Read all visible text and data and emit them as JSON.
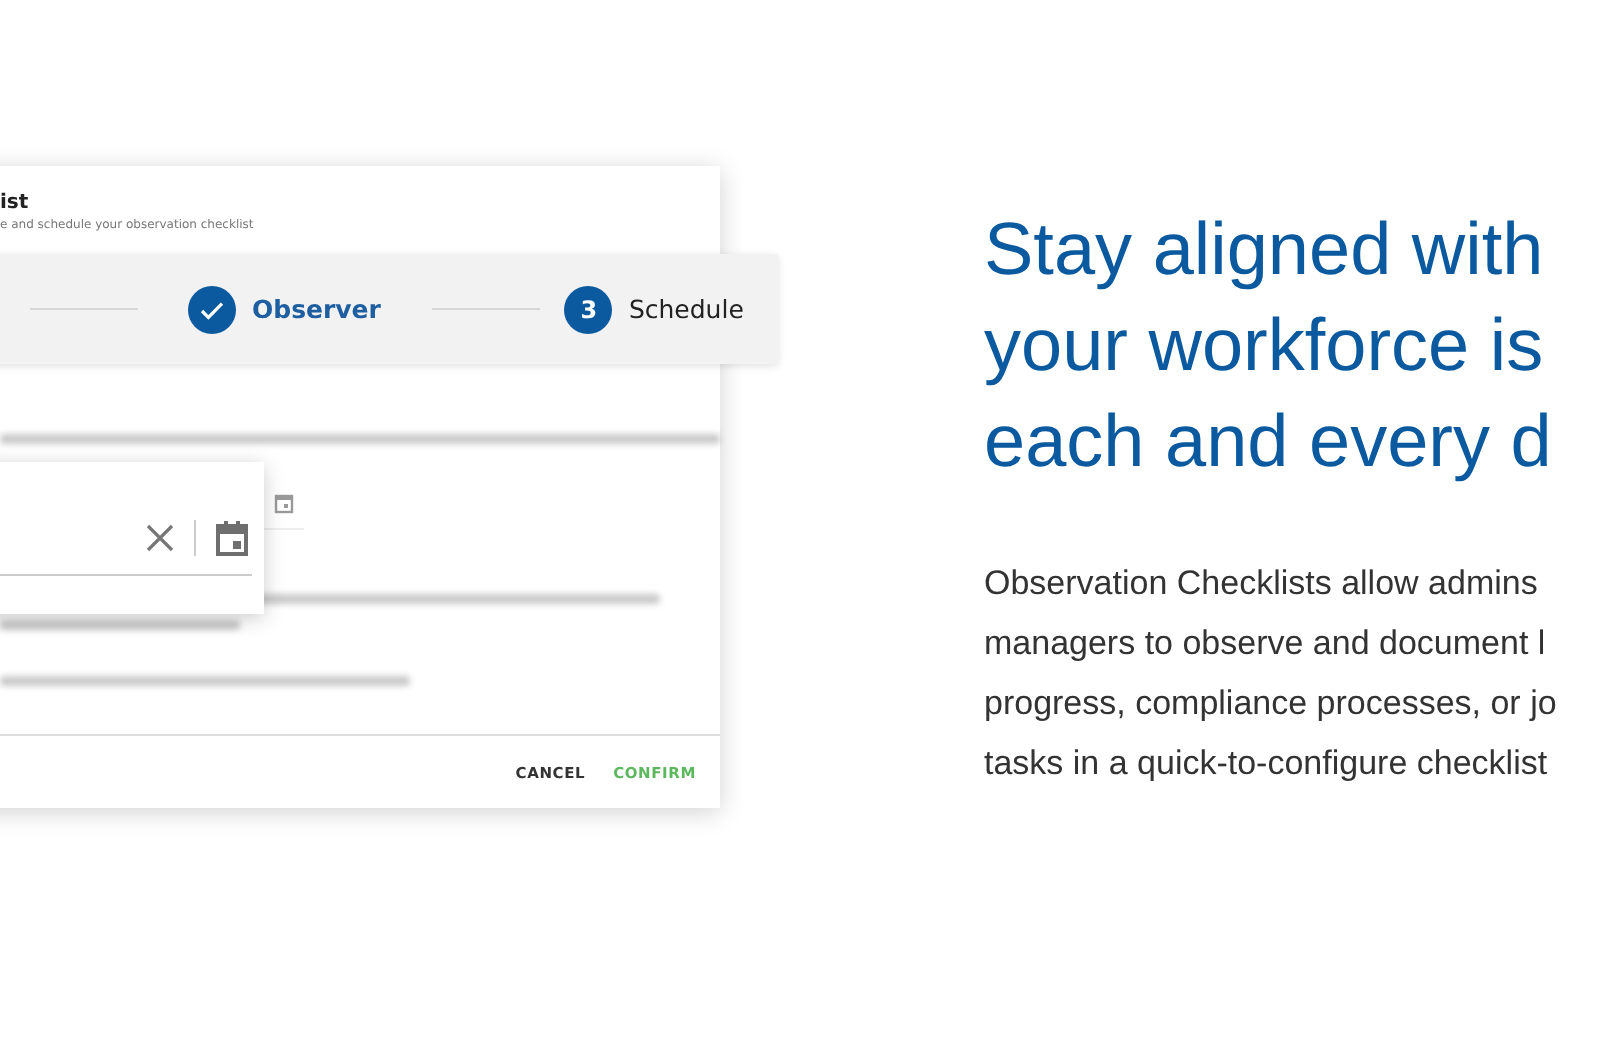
{
  "dialog": {
    "title": "ist",
    "subtitle": "e and schedule your observation checklist",
    "steps": [
      {
        "label": "Observer",
        "kind": "done"
      },
      {
        "label": "Schedule",
        "kind": "numbered",
        "number": "3"
      }
    ],
    "buttons": [
      {
        "label": "CANCEL",
        "kind": "plain"
      },
      {
        "label": "CONFIRM",
        "kind": "primary"
      }
    ]
  },
  "headline": [
    "Stay aligned with",
    "your workforce is",
    "each and every d"
  ],
  "description": [
    "Observation Checklists allow admins",
    "managers to observe and document l",
    "progress, compliance processes, or jo",
    "tasks in a quick-to-configure checklist"
  ]
}
